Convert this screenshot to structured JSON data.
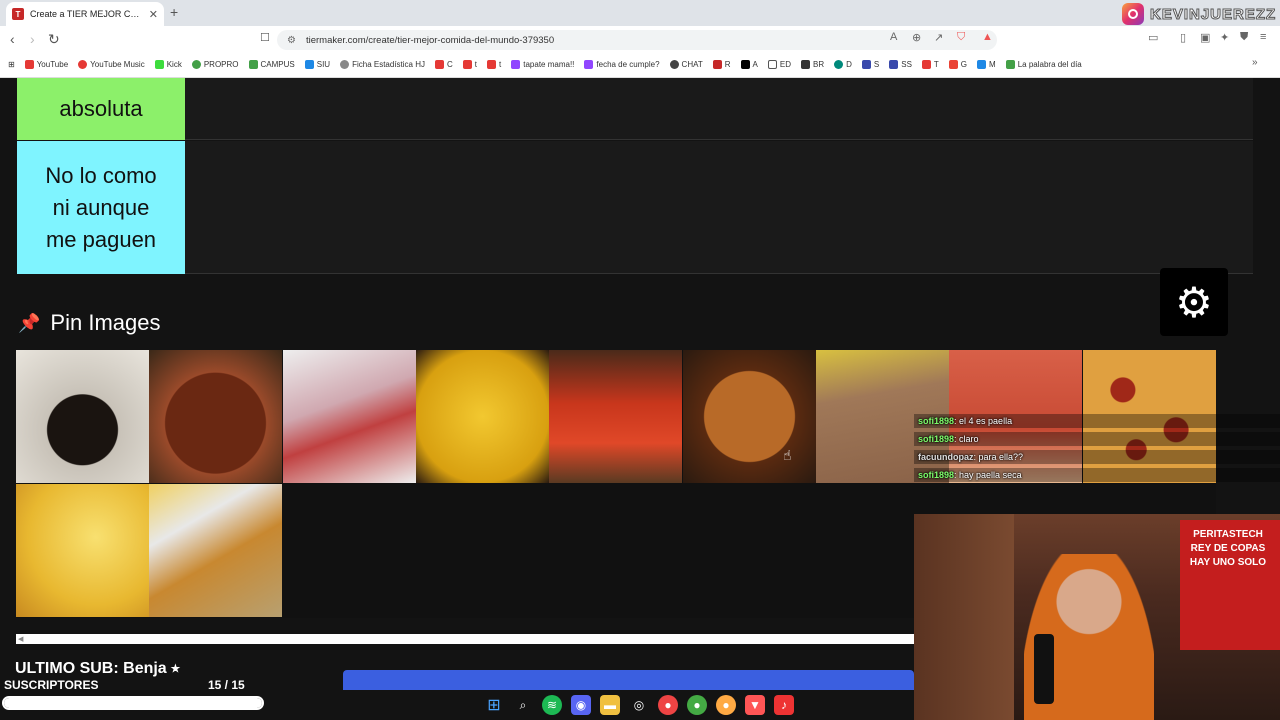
{
  "browser": {
    "tab_title": "Create a TIER MEJOR COMIDA D",
    "tab_close": "✕",
    "new_tab": "+",
    "url": "tiermaker.com/create/tier-mejor-comida-del-mundo-379350",
    "instagram_handle": "KEVINJUEREZZ",
    "bookmarks": [
      {
        "label": "YouTube",
        "color": "#e53935"
      },
      {
        "label": "YouTube Music",
        "color": "#e53935"
      },
      {
        "label": "Kick",
        "color": "#3ddc3d"
      },
      {
        "label": "PROPRO",
        "color": "#43a047"
      },
      {
        "label": "CAMPUS",
        "color": "#43a047"
      },
      {
        "label": "SIU",
        "color": "#1e88e5"
      },
      {
        "label": "Ficha Estadística HJ",
        "color": "#888888"
      },
      {
        "label": "C",
        "color": "#e53935"
      },
      {
        "label": "t",
        "color": "#e53935"
      },
      {
        "label": "t",
        "color": "#e53935"
      },
      {
        "label": "tapate mama!!",
        "color": "#9146ff"
      },
      {
        "label": "fecha de cumple?",
        "color": "#9146ff"
      },
      {
        "label": "CHAT",
        "color": "#444444"
      },
      {
        "label": "R",
        "color": "#c62828"
      },
      {
        "label": "A",
        "color": "#000000"
      },
      {
        "label": "ED",
        "color": "#555555"
      },
      {
        "label": "BR",
        "color": "#333333"
      },
      {
        "label": "D",
        "color": "#00897b"
      },
      {
        "label": "S",
        "color": "#3949ab"
      },
      {
        "label": "SS",
        "color": "#3949ab"
      },
      {
        "label": "T",
        "color": "#e53935"
      },
      {
        "label": "G",
        "color": "#ea4335"
      },
      {
        "label": "M",
        "color": "#1e88e5"
      },
      {
        "label": "La palabra del día",
        "color": "#43a047"
      }
    ]
  },
  "tiers": [
    {
      "label": "absoluta",
      "color": "#8cf06a"
    },
    {
      "label": "No lo como ni aunque me paguen",
      "color": "#7ff4ff"
    }
  ],
  "pin_images": {
    "title": "Pin Images",
    "items": [
      {
        "name": "bat-soup",
        "color": "#3a3430"
      },
      {
        "name": "snails",
        "color": "#8a3b22"
      },
      {
        "name": "ham-rolls",
        "color": "#c9a0a8"
      },
      {
        "name": "pasta",
        "color": "#e6b81c"
      },
      {
        "name": "gazpacho",
        "color": "#c0331c"
      },
      {
        "name": "roast-chicken",
        "color": "#7a3a14"
      },
      {
        "name": "meatloaf",
        "color": "#9a7052"
      },
      {
        "name": "tomato-pizza",
        "color": "#c8553c"
      },
      {
        "name": "pepperoni-pizza",
        "color": "#b03a1a"
      },
      {
        "name": "pineapple-pizza",
        "color": "#e8c040"
      },
      {
        "name": "milanesa",
        "color": "#c08030"
      }
    ]
  },
  "chat": [
    {
      "user": "sofi1898",
      "text": ": el 4 es paella"
    },
    {
      "user": "sofi1898",
      "text": ": claro"
    },
    {
      "user": "facuundopaz",
      "text": ": para ella??"
    },
    {
      "user": "sofi1898",
      "text": ": hay paella seca"
    }
  ],
  "stream": {
    "last_sub": "ULTIMO SUB: Benja ⭑",
    "subs_label": "SUSCRIPTORES",
    "subs_count": "15  / 15",
    "subs_progress": 1.0,
    "webcam_banner": "PERITASTECH REY DE COPAS HAY UNO SOLO"
  }
}
